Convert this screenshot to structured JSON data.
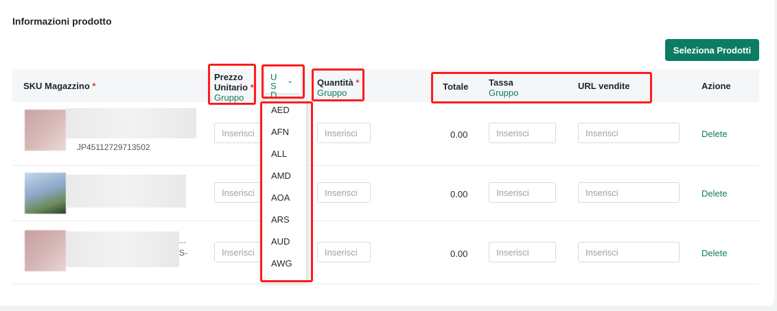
{
  "section": {
    "title": "Informazioni prodotto"
  },
  "toolbar": {
    "select_products_label": "Seleziona Prodotti"
  },
  "table": {
    "headers": {
      "sku": "SKU Magazzino",
      "price": "Prezzo Unitario",
      "price_group": "Gruppo",
      "currency": "USD",
      "quantity": "Quantità",
      "quantity_group": "Gruppo",
      "total": "Totale",
      "tax": "Tassa",
      "tax_group": "Gruppo",
      "url": "URL vendite",
      "action": "Azione",
      "required_mark": "*"
    },
    "rows": [
      {
        "sku_suffix": "JP45112729713502",
        "price_placeholder": "Inserisci",
        "qty_placeholder": "Inserisci",
        "total": "0.00",
        "tax_placeholder": "Inserisci",
        "url_placeholder": "Inserisci",
        "action": "Delete"
      },
      {
        "price_placeholder": "Inserisci",
        "qty_placeholder": "Inserisci",
        "total": "0.00",
        "tax_placeholder": "Inserisci",
        "url_placeholder": "Inserisci",
        "action": "Delete"
      },
      {
        "name_fragment": "...",
        "sku_suffix": "S-",
        "price_placeholder": "Inserisci",
        "qty_placeholder": "Inserisci",
        "total": "0.00",
        "tax_placeholder": "Inserisci",
        "url_placeholder": "Inserisci",
        "action": "Delete"
      }
    ]
  },
  "currency_dropdown": {
    "options": [
      "AED",
      "AFN",
      "ALL",
      "AMD",
      "AOA",
      "ARS",
      "AUD",
      "AWG"
    ]
  },
  "colors": {
    "accent": "#0c7c63",
    "required": "#e03a3a",
    "highlight": "#ff1a1a"
  }
}
